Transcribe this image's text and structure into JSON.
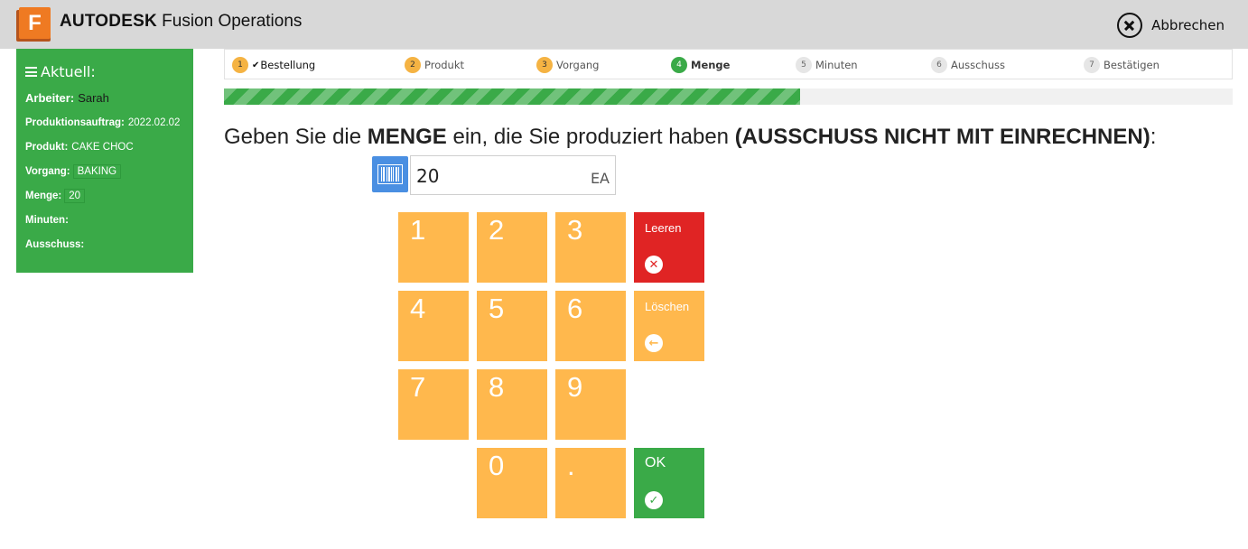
{
  "app": {
    "logo_letter": "F",
    "brand_bold": "AUTODESK",
    "brand_rest": "Fusion Operations",
    "cancel_label": "Abbrechen"
  },
  "sidebar": {
    "title": "Aktuell:",
    "rows": [
      {
        "label": "Arbeiter:",
        "value": "Sarah"
      },
      {
        "label": "Produktionsauftrag:",
        "value": "2022.02.02"
      },
      {
        "label": "Produkt:",
        "value": "CAKE CHOC"
      },
      {
        "label": "Vorgang:",
        "value": "BAKING"
      },
      {
        "label": "Menge:",
        "value": "20"
      },
      {
        "label": "Minuten:",
        "value": ""
      },
      {
        "label": "Ausschuss:",
        "value": ""
      }
    ]
  },
  "steps": [
    {
      "num": "1",
      "label": "Bestellung",
      "state": "done",
      "check": "✔"
    },
    {
      "num": "2",
      "label": "Produkt",
      "state": "done"
    },
    {
      "num": "3",
      "label": "Vorgang",
      "state": "done"
    },
    {
      "num": "4",
      "label": "Menge",
      "state": "active"
    },
    {
      "num": "5",
      "label": "Minuten",
      "state": "todo"
    },
    {
      "num": "6",
      "label": "Ausschuss",
      "state": "todo"
    },
    {
      "num": "7",
      "label": "Bestätigen",
      "state": "todo"
    }
  ],
  "progress": {
    "fraction": 0.571
  },
  "question": {
    "part1": "Geben Sie die ",
    "bold1": "MENGE",
    "part2": " ein, die Sie produziert haben ",
    "bold2": "(AUSSCHUSS NICHT MIT EINRECHNEN)",
    "part3": ":"
  },
  "quantity": {
    "value": "20",
    "unit": "EA"
  },
  "keypad": {
    "digits": [
      "1",
      "2",
      "3",
      "4",
      "5",
      "6",
      "7",
      "8",
      "9",
      "0",
      "."
    ],
    "clear_label": "Leeren",
    "delete_label": "Löschen",
    "ok_label": "OK"
  },
  "colors": {
    "green": "#3aaa48",
    "orange": "#ffb84d",
    "red": "#e02424",
    "blue": "#4a8fe2",
    "topbar": "#d8d8d8"
  }
}
